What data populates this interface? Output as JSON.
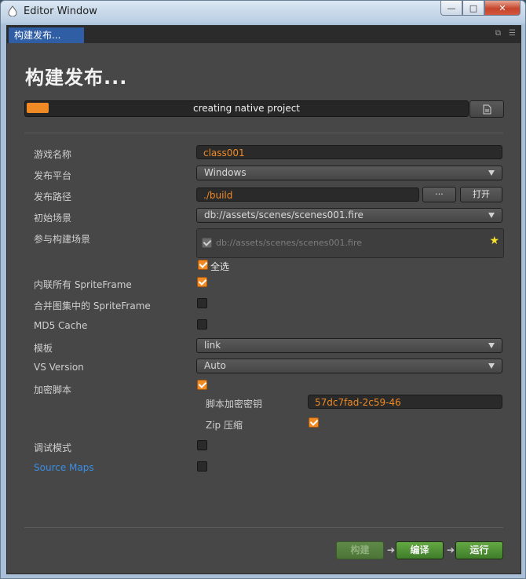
{
  "window": {
    "title": "Editor Window",
    "min_label": "—",
    "max_label": "□",
    "close_label": "✕"
  },
  "tab": {
    "label": "构建发布..."
  },
  "heading": "构建发布...",
  "progress": {
    "text": "creating native project",
    "percent": 5
  },
  "form": {
    "game_name": {
      "label": "游戏名称",
      "value": "class001"
    },
    "platform": {
      "label": "发布平台",
      "value": "Windows"
    },
    "build_path": {
      "label": "发布路径",
      "value": "./build",
      "browse_label": "···",
      "open_label": "打开"
    },
    "start_scene": {
      "label": "初始场景",
      "value": "db://assets/scenes/scenes001.fire"
    },
    "scenes": {
      "label": "参与构建场景",
      "items": [
        "db://assets/scenes/scenes001.fire"
      ],
      "select_all_label": "全选"
    },
    "inline_sprite": {
      "label": "内联所有 SpriteFrame",
      "checked": true
    },
    "merge_sprite": {
      "label": "合并图集中的 SpriteFrame",
      "checked": false
    },
    "md5": {
      "label": "MD5 Cache",
      "checked": false
    },
    "template": {
      "label": "模板",
      "value": "link"
    },
    "vs_version": {
      "label": "VS Version",
      "value": "Auto"
    },
    "encrypt": {
      "label": "加密脚本",
      "checked": true,
      "key_label": "脚本加密密钥",
      "key_value": "57dc7fad-2c59-46",
      "zip_label": "Zip 压缩",
      "zip_checked": true
    },
    "debug": {
      "label": "调试模式",
      "checked": false
    },
    "source_maps": {
      "label": "Source Maps",
      "checked": false
    }
  },
  "actions": {
    "build_label": "构建",
    "compile_label": "编译",
    "run_label": "运行",
    "arrow": "➔"
  },
  "colors": {
    "accent": "#f08a24",
    "panel": "#474747",
    "link": "#3a8ee6",
    "green": "#4e9233"
  }
}
